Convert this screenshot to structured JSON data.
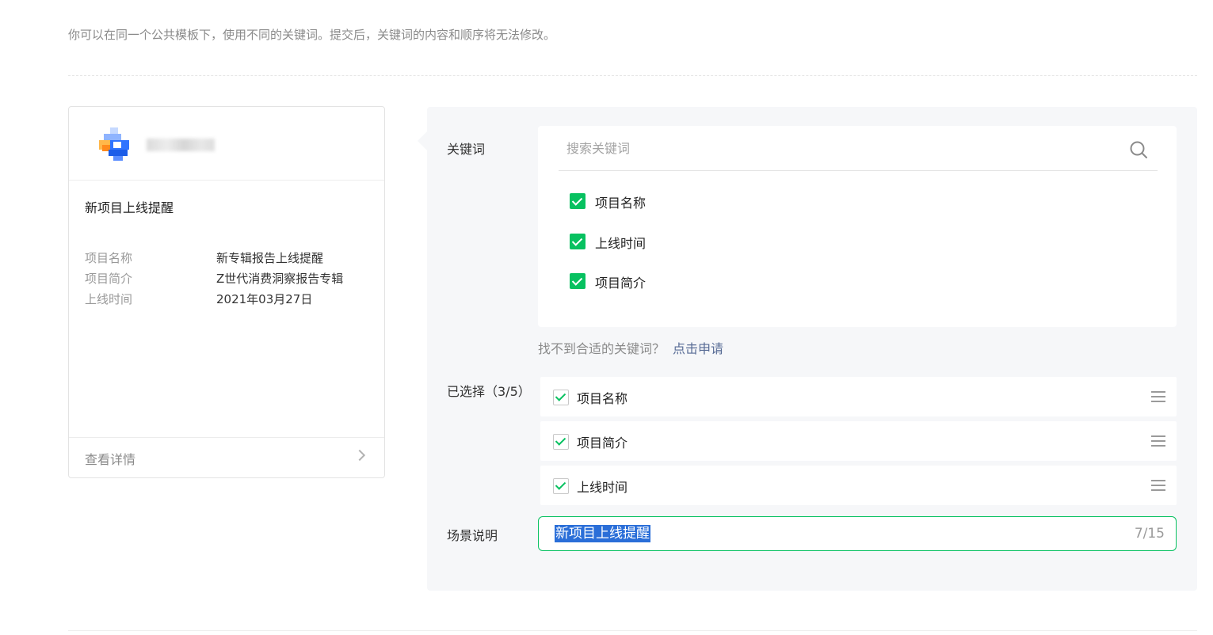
{
  "intro_text": "你可以在同一个公共模板下，使用不同的关键词。提交后，关键词的内容和顺序将无法修改。",
  "preview": {
    "title": "新项目上线提醒",
    "fields": [
      {
        "label": "项目名称",
        "value": "新专辑报告上线提醒"
      },
      {
        "label": "项目简介",
        "value": "Z世代消费洞察报告专辑"
      },
      {
        "label": "上线时间",
        "value": "2021年03月27日"
      }
    ],
    "footer_label": "查看详情"
  },
  "keywords": {
    "label": "关键词",
    "search_placeholder": "搜索关键词",
    "options": [
      {
        "label": "项目名称",
        "checked": true
      },
      {
        "label": "上线时间",
        "checked": true
      },
      {
        "label": "项目简介",
        "checked": true
      }
    ],
    "hint_text": "找不到合适的关键词？",
    "hint_link": "点击申请"
  },
  "selected": {
    "label": "已选择（3/5）",
    "items": [
      {
        "label": "项目名称"
      },
      {
        "label": "项目简介"
      },
      {
        "label": "上线时间"
      }
    ]
  },
  "scene": {
    "label": "场景说明",
    "value": "新项目上线提醒",
    "count": "7/15"
  },
  "colors": {
    "accent_green": "#07c160",
    "link_blue": "#576b95",
    "selection_blue": "#2a6ed8"
  }
}
